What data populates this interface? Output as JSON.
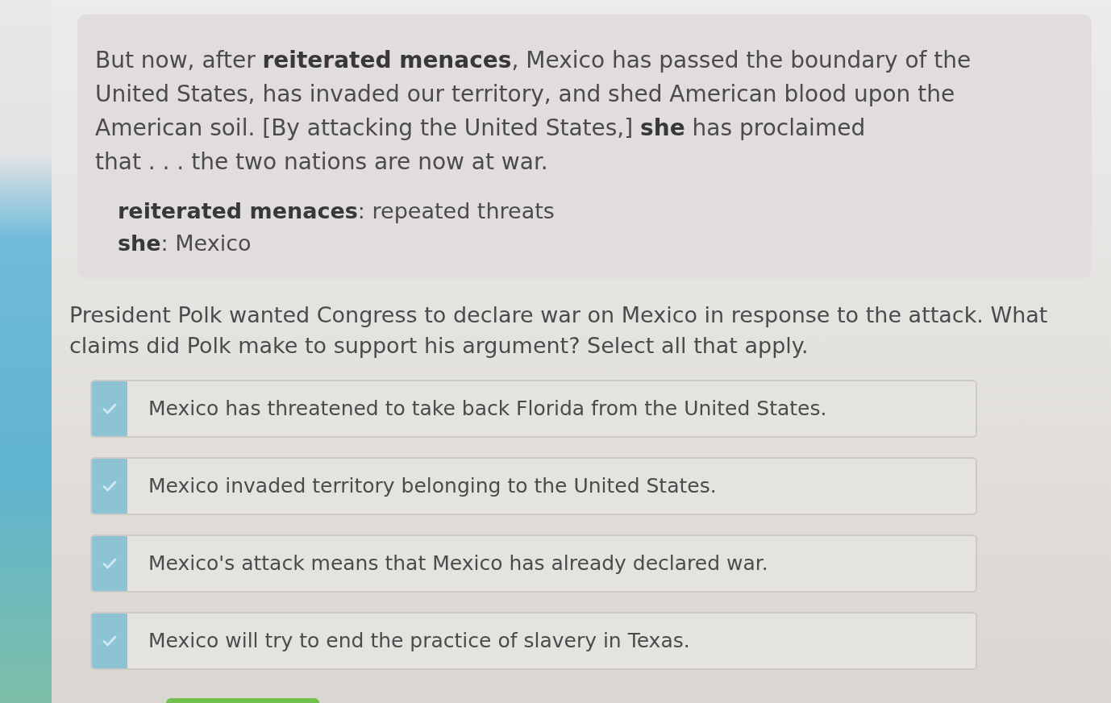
{
  "passage": {
    "lines": [
      "But now, after **reiterated menaces**, Mexico has passed the boundary of the",
      "United States, has invaded our territory, and shed American blood upon the",
      "American soil. [By attacking the United States,] **she** has proclaimed",
      "that . . . the two nations are now at war."
    ],
    "glossary": [
      "**reiterated menaces**: repeated threats",
      "**she**: Mexico"
    ]
  },
  "question": "President Polk wanted Congress to declare war on Mexico in response to the attack. What claims did Polk make to support his argument? Select all that apply.",
  "options": [
    {
      "text": "Mexico has threatened to take back Florida from the United States.",
      "selected": false
    },
    {
      "text": "Mexico invaded territory belonging to the United States.",
      "selected": false
    },
    {
      "text": "Mexico's attack means that Mexico has already declared war.",
      "selected": false
    },
    {
      "text": "Mexico will try to end the practice of slavery in Texas.",
      "selected": false
    }
  ]
}
